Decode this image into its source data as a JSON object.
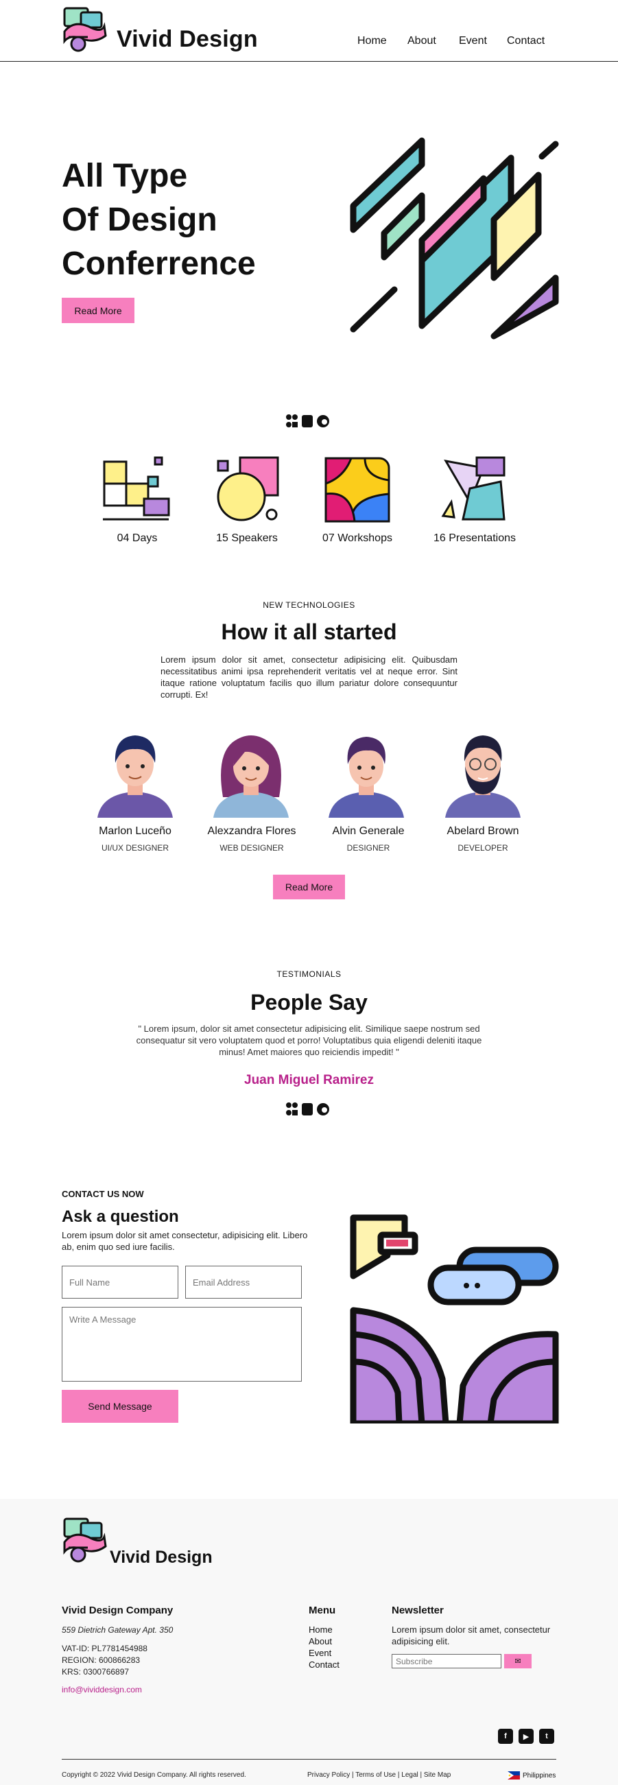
{
  "header": {
    "brand": "Vivid Design",
    "nav": [
      "Home",
      "About",
      "Event",
      "Contact"
    ]
  },
  "hero": {
    "title_lines": [
      "All Type",
      "Of Design",
      "Conferrence"
    ],
    "cta": "Read More"
  },
  "stats": [
    {
      "label": "04 Days"
    },
    {
      "label": "15 Speakers"
    },
    {
      "label": "07 Workshops"
    },
    {
      "label": "16 Presentations"
    }
  ],
  "about": {
    "eyebrow": "NEW TECHNOLOGIES",
    "title": "How it all started",
    "text": "Lorem ipsum dolor sit amet, consectetur adipisicing elit. Quibusdam necessitatibus animi ipsa reprehenderit veritatis vel at neque error. Sint itaque ratione voluptatum facilis quo illum pariatur dolore consequuntur corrupti. Ex!",
    "cta": "Read More"
  },
  "team": [
    {
      "name": "Marlon Luceño",
      "role": "UI/UX DESIGNER"
    },
    {
      "name": "Alexzandra Flores",
      "role": "WEB DESIGNER"
    },
    {
      "name": "Alvin Generale",
      "role": "DESIGNER"
    },
    {
      "name": "Abelard Brown",
      "role": "DEVELOPER"
    }
  ],
  "testimonials": {
    "eyebrow": "TESTIMONIALS",
    "title": "People Say",
    "quote": "\" Lorem ipsum, dolor sit amet consectetur adipisicing elit. Similique saepe nostrum sed consequatur sit vero voluptatem quod et porro! Voluptatibus quia eligendi deleniti itaque minus! Amet maiores quo reiciendis impedit! \"",
    "author": "Juan Miguel Ramirez"
  },
  "contact": {
    "eyebrow": "CONTACT US NOW",
    "title": "Ask a question",
    "text": "Lorem ipsum dolor sit amet consectetur, adipisicing elit. Libero ab, enim quo sed iure facilis.",
    "name_placeholder": "Full Name",
    "email_placeholder": "Email Address",
    "message_placeholder": "Write A Message",
    "send": "Send Message"
  },
  "footer": {
    "brand": "Vivid Design",
    "company": "Vivid Design Company",
    "address": "559 Dietrich Gateway Apt. 350",
    "vat": "VAT-ID: PL7781454988",
    "region": "REGION: 600866283",
    "krs": "KRS: 0300766897",
    "email": "info@vividdesign.com",
    "menu_title": "Menu",
    "menu": [
      "Home",
      "About",
      "Event",
      "Contact"
    ],
    "newsletter_title": "Newsletter",
    "newsletter_text": "Lorem ipsum dolor sit amet, consectetur adipisicing elit.",
    "subscribe_placeholder": "Subscribe",
    "copyright": "Copyright © 2022 Vivid Design Company. All rights reserved.",
    "legal": "Privacy Policy | Terms of Use | Legal | Site Map",
    "country": "Philippines"
  },
  "colors": {
    "pink": "#f77fbe",
    "teal": "#6fcbd3",
    "purple": "#b888dd",
    "author": "#b8208a"
  },
  "icons": [
    "facebook-icon",
    "youtube-icon",
    "twitter-icon",
    "mail-icon",
    "flag-icon"
  ]
}
